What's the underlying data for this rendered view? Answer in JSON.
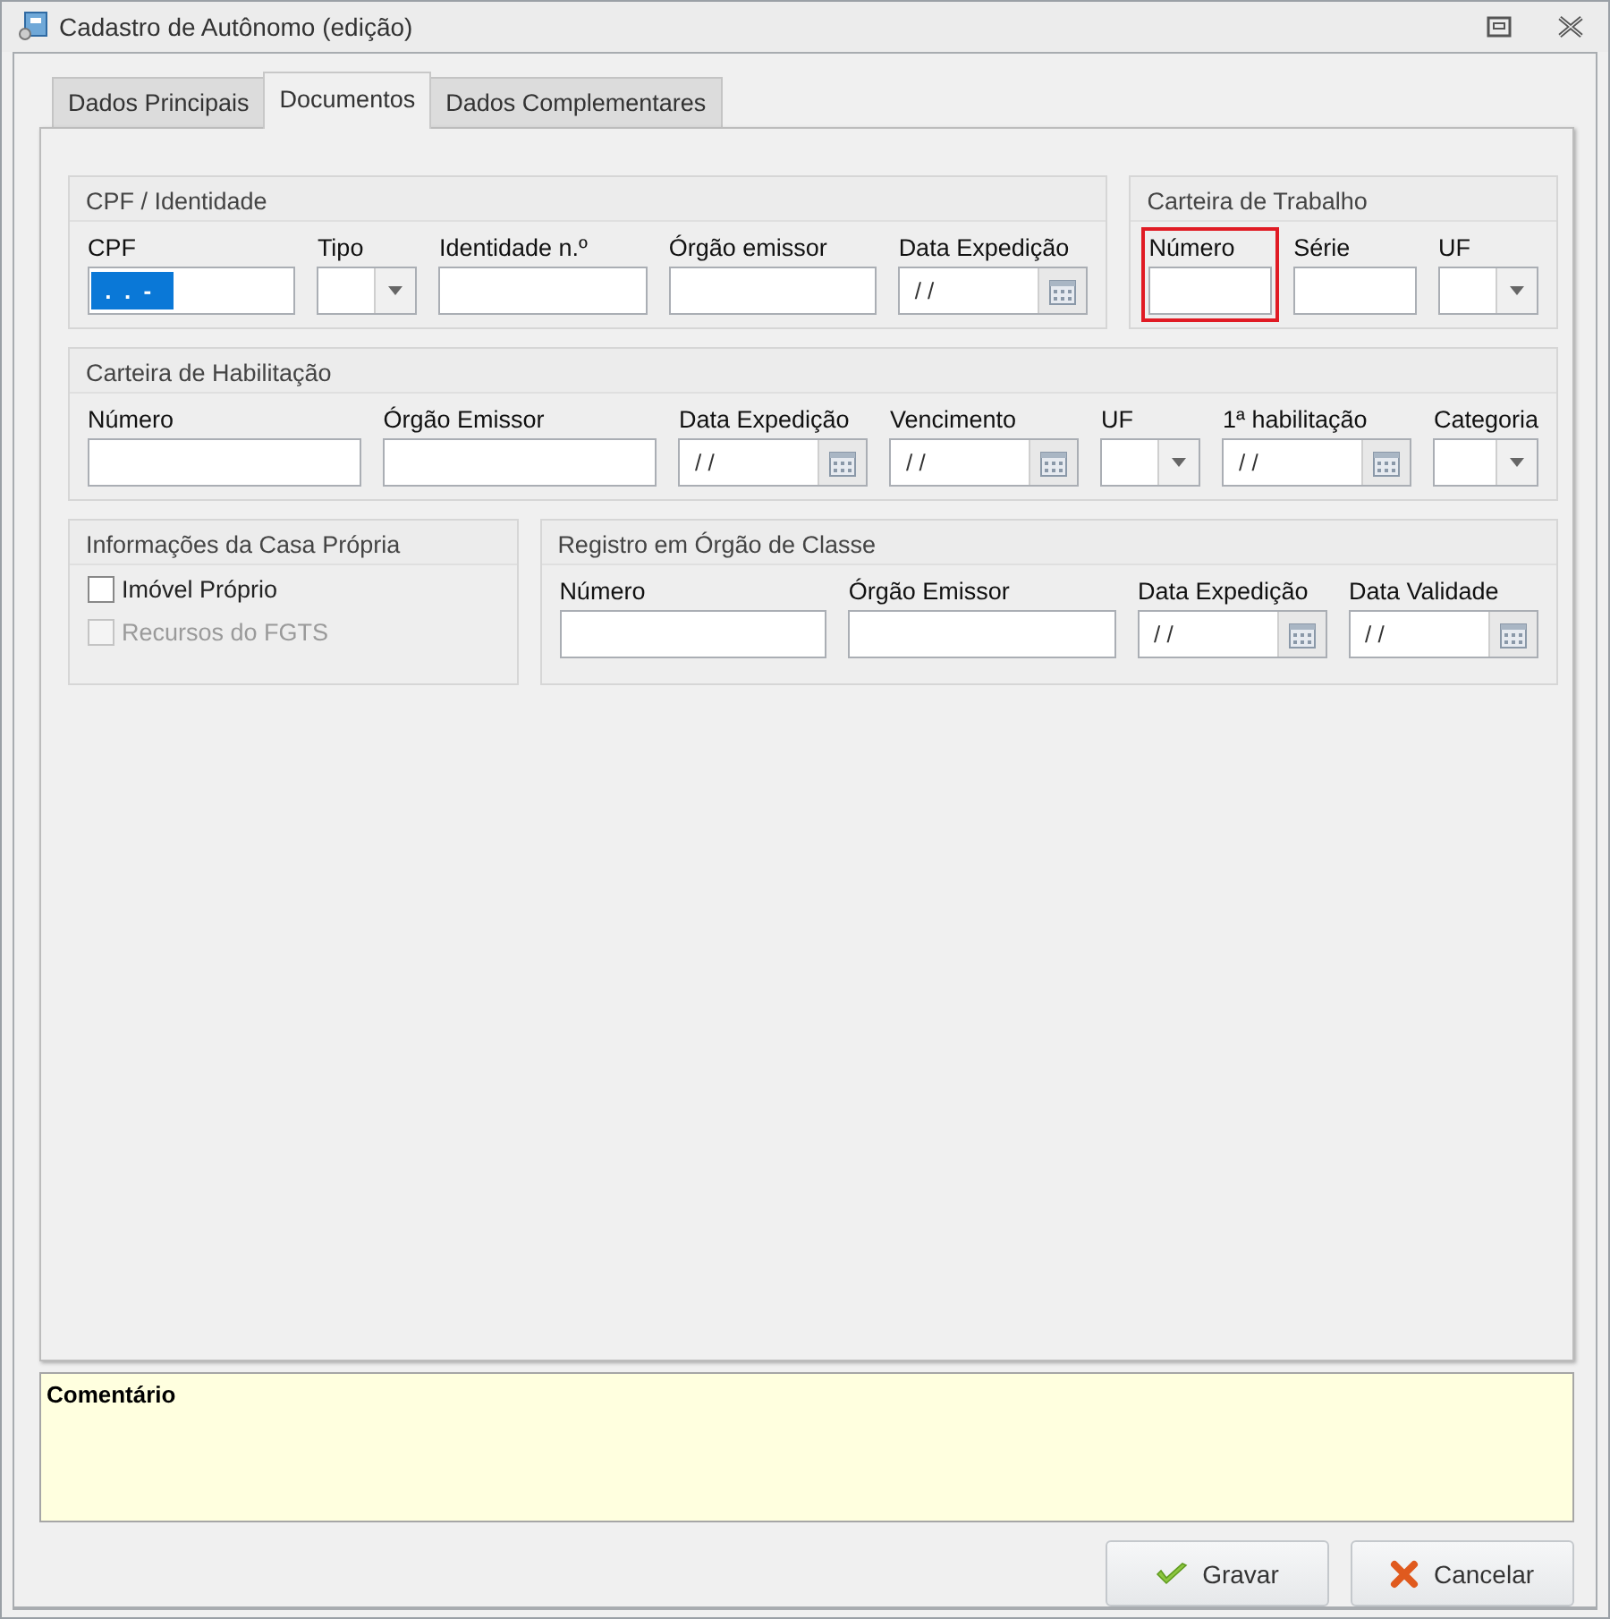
{
  "window": {
    "title": "Cadastro de Autônomo (edição)"
  },
  "tabs": [
    {
      "label": "Dados Principais",
      "selected": false
    },
    {
      "label": "Documentos",
      "selected": true
    },
    {
      "label": "Dados Complementares",
      "selected": false
    }
  ],
  "groups_row1": [
    {
      "title": "CPF / Identidade",
      "fields": [
        {
          "kind": "text",
          "label": "CPF",
          "value": " .  .  -",
          "selected": true
        },
        {
          "kind": "combo",
          "label": "Tipo"
        },
        {
          "kind": "text",
          "label": "Identidade n.º"
        },
        {
          "kind": "text",
          "label": "Órgão emissor"
        },
        {
          "kind": "date",
          "label": "Data Expedição",
          "value": "/ /"
        }
      ]
    },
    {
      "title": "Carteira de Trabalho",
      "fields": [
        {
          "kind": "text",
          "label": "Número",
          "highlighted": true
        },
        {
          "kind": "text",
          "label": "Série"
        },
        {
          "kind": "combo",
          "label": "UF"
        }
      ]
    }
  ],
  "groups_row2": [
    {
      "title": "Carteira de Habilitação",
      "fields": [
        {
          "kind": "text",
          "label": "Número"
        },
        {
          "kind": "text",
          "label": "Órgão Emissor"
        },
        {
          "kind": "date",
          "label": "Data Expedição",
          "value": "/ /"
        },
        {
          "kind": "date",
          "label": "Vencimento",
          "value": "/ /"
        },
        {
          "kind": "combo",
          "label": "UF"
        },
        {
          "kind": "date",
          "label": "1ª habilitação",
          "value": "/ /"
        },
        {
          "kind": "combo",
          "label": "Categoria"
        }
      ]
    }
  ],
  "casa_propria": {
    "title": "Informações da Casa Própria",
    "checkboxes": [
      {
        "label": "Imóvel Próprio",
        "checked": false,
        "disabled": false
      },
      {
        "label": "Recursos do FGTS",
        "checked": false,
        "disabled": true
      }
    ]
  },
  "registro": {
    "title": "Registro em Órgão de Classe",
    "fields": [
      {
        "kind": "text",
        "label": "Número"
      },
      {
        "kind": "text",
        "label": "Órgão Emissor"
      },
      {
        "kind": "date",
        "label": "Data Expedição",
        "value": "/ /"
      },
      {
        "kind": "date",
        "label": "Data Validade",
        "value": "/ /"
      }
    ]
  },
  "comment": {
    "label": "Comentário"
  },
  "buttons": [
    {
      "kind": "ok",
      "label": "Gravar"
    },
    {
      "kind": "cancel",
      "label": "Cancelar"
    }
  ]
}
